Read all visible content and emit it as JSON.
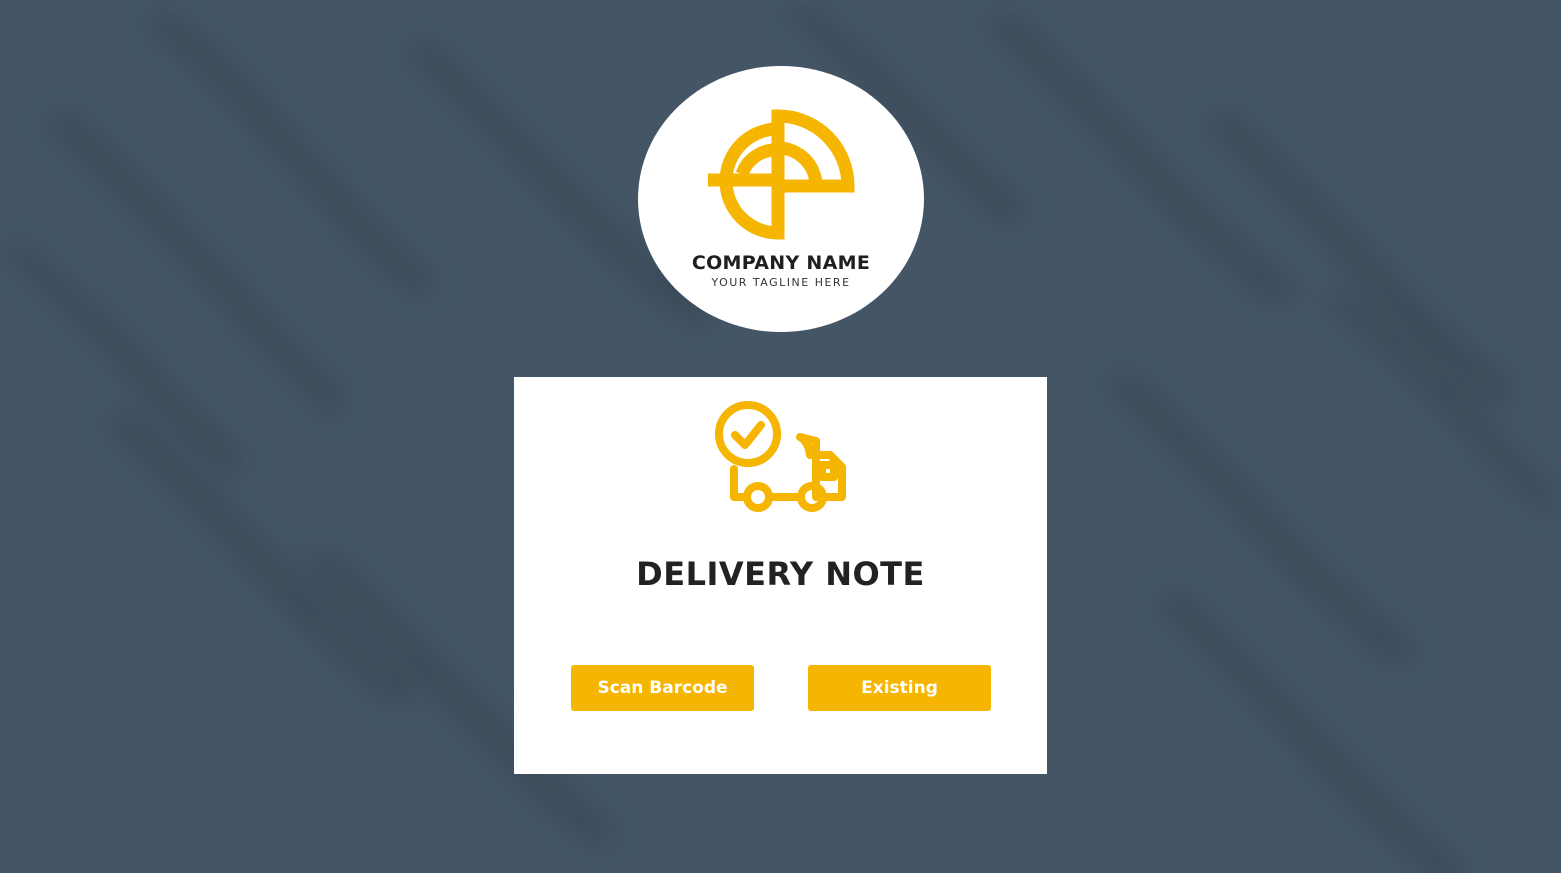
{
  "logo": {
    "company_name": "COMPANY NAME",
    "tagline": "YOUR TAGLINE HERE",
    "brand_color": "#f5b500"
  },
  "card": {
    "icon": "delivery-truck-check-icon",
    "title": "DELIVERY NOTE",
    "buttons": {
      "scan_label": "Scan Barcode",
      "existing_label": "Existing"
    }
  },
  "colors": {
    "background": "#445666",
    "accent": "#f5b500",
    "card": "#ffffff",
    "title_text": "#222222"
  }
}
